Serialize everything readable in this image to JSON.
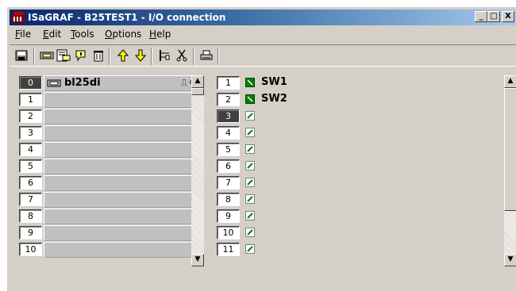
{
  "window": {
    "title": "ISaGRAF - B25TEST1 - I/O connection",
    "minimize_label": "_",
    "maximize_label": "□",
    "close_label": "X"
  },
  "menu": [
    {
      "ul": "F",
      "rest": "ile"
    },
    {
      "ul": "E",
      "rest": "dit"
    },
    {
      "ul": "T",
      "rest": "ools"
    },
    {
      "ul": "O",
      "rest": "ptions"
    },
    {
      "ul": "H",
      "rest": "elp"
    }
  ],
  "toolbar": {
    "icons": [
      "save-icon",
      "connect-board-icon",
      "board-parameters-icon",
      "board-info-icon",
      "delete-board-icon",
      "move-up-icon",
      "move-down-icon",
      "set-channel-icon",
      "cut-icon",
      "print-icon"
    ]
  },
  "boards": {
    "items": [
      {
        "index": "0",
        "name": "bl25di",
        "selected": true,
        "extra1": "⎍",
        "extra2": "⇦"
      },
      {
        "index": "1",
        "name": ""
      },
      {
        "index": "2",
        "name": ""
      },
      {
        "index": "3",
        "name": ""
      },
      {
        "index": "4",
        "name": ""
      },
      {
        "index": "5",
        "name": ""
      },
      {
        "index": "6",
        "name": ""
      },
      {
        "index": "7",
        "name": ""
      },
      {
        "index": "8",
        "name": ""
      },
      {
        "index": "9",
        "name": ""
      },
      {
        "index": "10",
        "name": ""
      }
    ]
  },
  "channels": {
    "items": [
      {
        "index": "1",
        "name": "SW1",
        "connected": true
      },
      {
        "index": "2",
        "name": "SW2",
        "connected": true
      },
      {
        "index": "3",
        "name": "",
        "connected": false,
        "selected": true
      },
      {
        "index": "4",
        "name": "",
        "connected": false
      },
      {
        "index": "5",
        "name": "",
        "connected": false
      },
      {
        "index": "6",
        "name": "",
        "connected": false
      },
      {
        "index": "7",
        "name": "",
        "connected": false
      },
      {
        "index": "8",
        "name": "",
        "connected": false
      },
      {
        "index": "9",
        "name": "",
        "connected": false
      },
      {
        "index": "10",
        "name": "",
        "connected": false
      },
      {
        "index": "11",
        "name": "",
        "connected": false
      }
    ]
  },
  "colors": {
    "title_start": "#0a246a",
    "title_end": "#a6caf0",
    "face": "#d4d0c8",
    "connected_icon": "#008000"
  }
}
